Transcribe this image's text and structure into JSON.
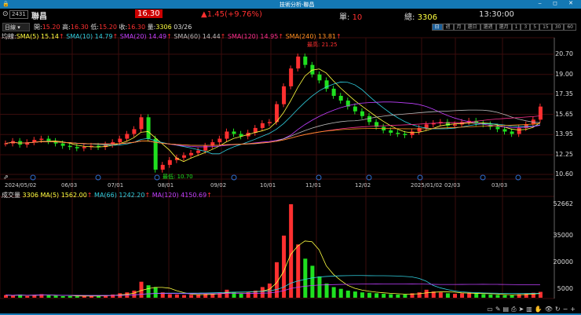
{
  "window": {
    "title": "技術分析-聯昌",
    "controls": "‒ ◻ ✕"
  },
  "quote": {
    "code": "2431",
    "name": "聯昌",
    "price": "16.30",
    "change": "▲1.45(+9.76%)",
    "single_label": "單:",
    "single": "10",
    "total_label": "總:",
    "total": "3306",
    "time": "13:30:00"
  },
  "ohlc": {
    "period": "日線",
    "open_label": "開:",
    "open": "15.20",
    "high_label": "高:",
    "high": "16.30",
    "low_label": "低:",
    "low": "15.20",
    "close_label": "收:",
    "close": "16.30",
    "vol_label": "量:",
    "vol": "3306",
    "date": "03/26"
  },
  "timeframes": [
    "日",
    "週",
    "月",
    "還日",
    "還週",
    "還月",
    "1",
    "3",
    "5",
    "15",
    "30",
    "60"
  ],
  "ma": {
    "label": "均線:",
    "sma5": "SMA(5) 15.14",
    "sma10": "SMA(10) 14.79",
    "sma20": "SMA(20) 14.49",
    "sma60": "SMA(60) 14.44",
    "sma120": "SMA(120) 14.95",
    "sma240": "SMA(240) 13.81"
  },
  "vma": {
    "label": "成交量",
    "vol": "3306",
    "ma5": "MA(5) 1562.00",
    "ma66": "MA(66) 1242.20",
    "ma120": "MA(120) 4150.69"
  },
  "colors": {
    "up": "#ff3030",
    "down": "#20e020",
    "bg": "#000000",
    "grid": "#3a0c0c"
  },
  "chart_data": {
    "type": "candlestick",
    "price_axis": [
      "20.70",
      "19.00",
      "17.35",
      "15.65",
      "13.95",
      "12.25",
      "10.60"
    ],
    "volume_axis": [
      "52662",
      "35000",
      "20000",
      "5000"
    ],
    "dates": [
      "2024/05/02",
      "06/03",
      "07/01",
      "08/01",
      "09/02",
      "10/01",
      "11/01",
      "12/02",
      "2025/01/02",
      "02/03",
      "03/03"
    ],
    "high_annotation": "最高: 21.25",
    "low_annotation": "最低: 10.70",
    "closes": [
      13.2,
      13.4,
      13.1,
      13.3,
      13.5,
      13.6,
      13.4,
      13.2,
      13.0,
      12.9,
      12.8,
      12.9,
      13.0,
      12.9,
      13.1,
      13.3,
      13.6,
      14.0,
      14.4,
      15.4,
      13.6,
      11.0,
      11.4,
      11.8,
      12.0,
      12.2,
      12.4,
      12.6,
      13.0,
      13.3,
      13.6,
      14.2,
      14.0,
      13.8,
      14.1,
      14.5,
      14.9,
      15.0,
      16.5,
      18.0,
      19.5,
      20.5,
      19.8,
      19.0,
      18.5,
      17.8,
      17.2,
      16.8,
      16.3,
      15.9,
      15.5,
      15.0,
      14.6,
      14.3,
      14.1,
      14.0,
      13.9,
      14.2,
      14.5,
      14.8,
      14.9,
      15.0,
      14.7,
      14.8,
      15.0,
      15.1,
      14.9,
      14.8,
      14.6,
      14.4,
      14.2,
      14.0,
      14.5,
      14.8,
      15.2,
      16.3
    ],
    "volumes": [
      1500,
      1200,
      1800,
      1000,
      1600,
      2000,
      1300,
      1100,
      900,
      1000,
      800,
      900,
      1200,
      1000,
      1400,
      1800,
      2500,
      3000,
      4000,
      9000,
      7000,
      6000,
      3000,
      2000,
      1800,
      1500,
      1600,
      1700,
      2200,
      2500,
      3000,
      4500,
      3000,
      2500,
      3000,
      4000,
      6000,
      8000,
      20000,
      35000,
      52662,
      30000,
      22000,
      18000,
      12000,
      8000,
      6000,
      5000,
      4000,
      3500,
      3000,
      2800,
      2500,
      2200,
      2000,
      1800,
      1800,
      2500,
      3000,
      4500,
      3500,
      3000,
      2500,
      2200,
      2500,
      2800,
      2300,
      2000,
      1800,
      1600,
      1500,
      1400,
      2000,
      2500,
      2800,
      3306
    ]
  }
}
